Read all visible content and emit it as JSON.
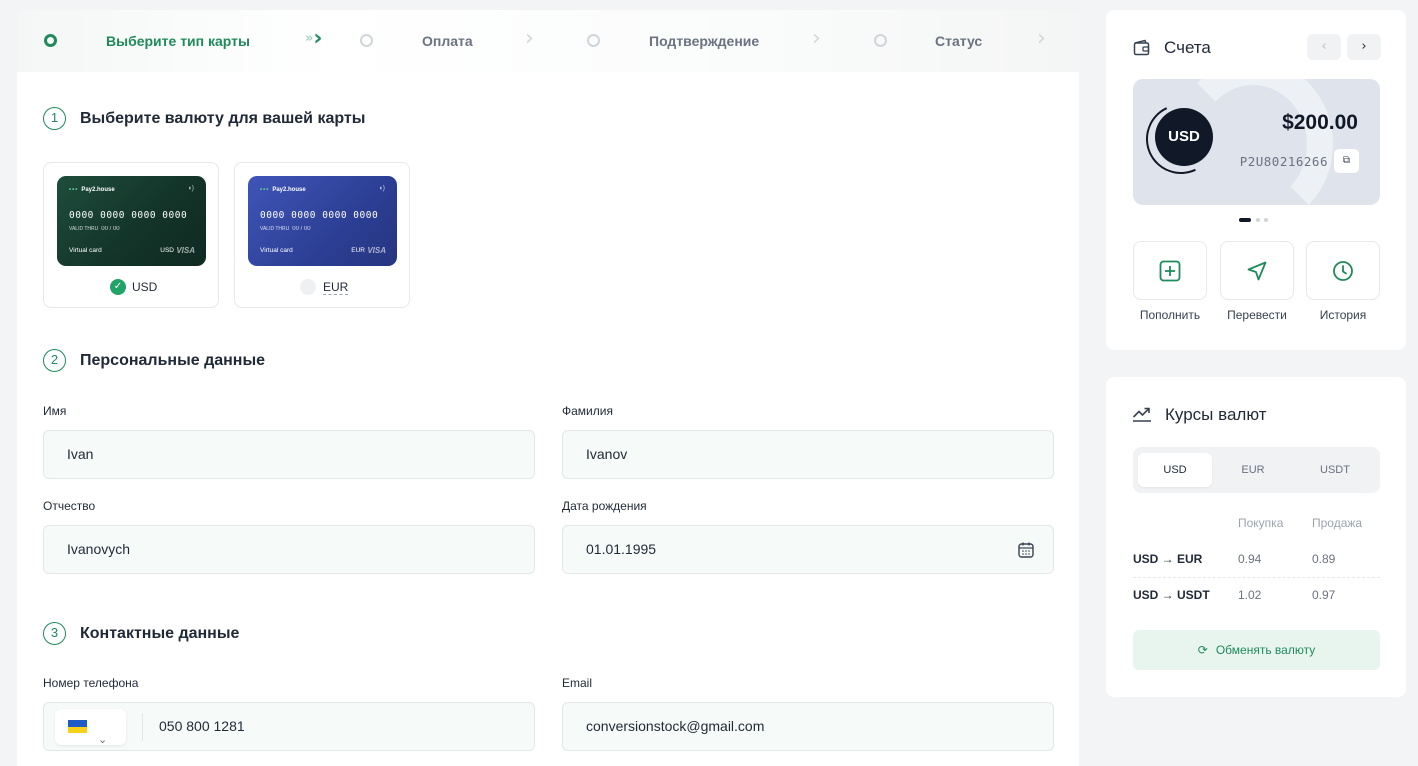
{
  "stepper": {
    "steps": [
      {
        "label": "Выберите тип карты",
        "active": true
      },
      {
        "label": "Оплата",
        "active": false
      },
      {
        "label": "Подтверждение",
        "active": false
      },
      {
        "label": "Статус",
        "active": false
      }
    ]
  },
  "sections": {
    "currency": {
      "num": "1",
      "title": "Выберите валюту для вашей карты"
    },
    "personal": {
      "num": "2",
      "title": "Персональные данные"
    },
    "contact": {
      "num": "3",
      "title": "Контактные данные"
    }
  },
  "currency_cards": [
    {
      "code": "USD",
      "selected": true,
      "brand": "Pay2.house",
      "number": "0000 0000 0000 0000",
      "valid_label": "VALID THRU",
      "valid": "00 / 00",
      "type": "Virtual card",
      "network": "VISA"
    },
    {
      "code": "EUR",
      "selected": false,
      "brand": "Pay2.house",
      "number": "0000 0000 0000 0000",
      "valid_label": "VALID THRU",
      "valid": "00 / 00",
      "type": "Virtual card",
      "network": "VISA"
    }
  ],
  "form": {
    "first_name": {
      "label": "Имя",
      "value": "Ivan"
    },
    "last_name": {
      "label": "Фамилия",
      "value": "Ivanov"
    },
    "middle_name": {
      "label": "Отчество",
      "value": "Ivanovych"
    },
    "birth_date": {
      "label": "Дата рождения",
      "value": "01.01.1995"
    },
    "phone": {
      "label": "Номер телефона",
      "value": "050 800 1281",
      "country": "UA"
    },
    "email": {
      "label": "Email",
      "value": "conversionstock@gmail.com"
    }
  },
  "accounts": {
    "title": "Счета",
    "currency": "USD",
    "amount": "$200.00",
    "account_number": "P2U80216266",
    "actions": [
      {
        "label": "Пополнить",
        "icon": "plus-square-icon"
      },
      {
        "label": "Перевести",
        "icon": "send-icon"
      },
      {
        "label": "История",
        "icon": "clock-icon"
      }
    ]
  },
  "rates": {
    "title": "Курсы валют",
    "tabs": [
      "USD",
      "EUR",
      "USDT"
    ],
    "active_tab": "USD",
    "col_buy": "Покупка",
    "col_sell": "Продажа",
    "rows": [
      {
        "pair": "USD → EUR",
        "buy": "0.94",
        "sell": "0.89"
      },
      {
        "pair": "USD → USDT",
        "buy": "1.02",
        "sell": "0.97"
      }
    ],
    "exchange_label": "Обменять валюту"
  },
  "colors": {
    "accent": "#1f8a5b",
    "accent_light": "#e8f5ee"
  }
}
